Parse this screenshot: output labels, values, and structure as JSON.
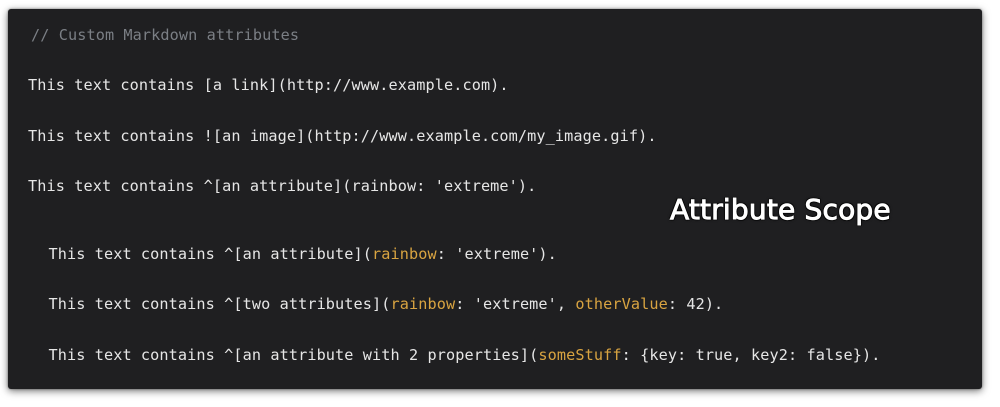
{
  "editor": {
    "comment": "// Custom Markdown attributes",
    "lines": [
      {
        "text": "This text contains [a link](http://www.example.com)."
      },
      {
        "text": "This text contains ![an image](http://www.example.com/my_image.gif)."
      },
      {
        "text": "This text contains ^[an attribute](rainbow: 'extreme')."
      },
      {
        "pre": "This text contains ^[an attribute](",
        "k1": "rainbow",
        "post": ": 'extreme')."
      },
      {
        "pre": "This text contains ^[two attributes](",
        "k1": "rainbow",
        "mid": ": 'extreme', ",
        "k2": "otherValue",
        "post": ": 42)."
      },
      {
        "pre": "This text contains ^[an attribute with 2 properties](",
        "k1": "someStuff",
        "post": ": {key: true, key2: false})."
      }
    ]
  },
  "overlay": {
    "caption": "Attribute Scope"
  },
  "colors": {
    "background": "#1f1f21",
    "text": "#e6e6e6",
    "comment": "#7b7f85",
    "property_highlight": "#d9a441"
  }
}
